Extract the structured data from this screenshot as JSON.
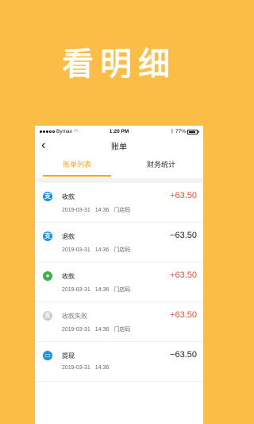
{
  "headline": "看明细",
  "status_bar": {
    "carrier": "Bymax",
    "time": "1:20 PM",
    "battery": "77%"
  },
  "nav": {
    "back_glyph": "‹",
    "title": "账单"
  },
  "tabs": [
    {
      "label": "账单列表",
      "active": true
    },
    {
      "label": "财务统计",
      "active": false
    }
  ],
  "transactions": [
    {
      "icon": "alipay-icon",
      "title": "收款",
      "date": "2019-03-31",
      "time": "14:36",
      "store": "门店码",
      "amount": "+63.50",
      "kind": "pos"
    },
    {
      "icon": "alipay-icon",
      "title": "退款",
      "date": "2019-03-31",
      "time": "14:36",
      "store": "门店码",
      "amount": "−63.50",
      "kind": "neg"
    },
    {
      "icon": "wechat-icon",
      "title": "收款",
      "date": "2019-03-31",
      "time": "14:36",
      "store": "门店码",
      "amount": "+63.50",
      "kind": "pos"
    },
    {
      "icon": "alipay-failed-icon",
      "title": "收款失败",
      "date": "2019-03-31",
      "time": "14:36",
      "store": "门店码",
      "amount": "+63.50",
      "kind": "pos"
    },
    {
      "icon": "card-icon",
      "title": "提现",
      "date": "2019-03-31",
      "time": "14:36",
      "store": "",
      "amount": "−63.50",
      "kind": "neg"
    }
  ],
  "colors": {
    "background": "#FBBD46",
    "accent": "#F5A623",
    "positive": "#E5532D",
    "alipay": "#1E8FE1",
    "wechat": "#37B24D"
  }
}
